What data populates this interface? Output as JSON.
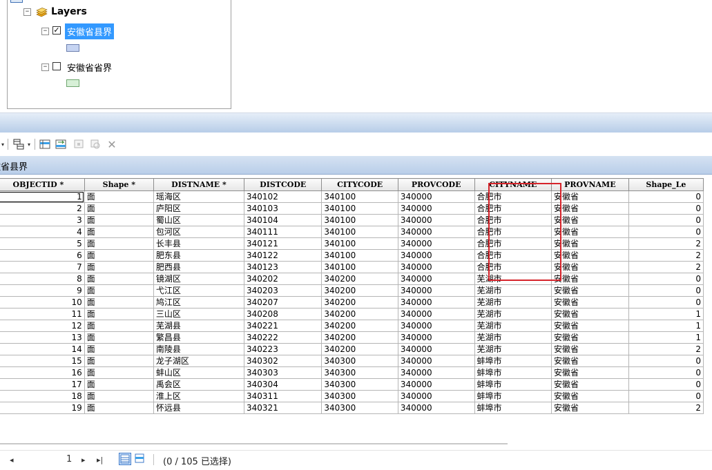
{
  "toc": {
    "root_label": "Layers",
    "layers": [
      {
        "name": "安徽省县界",
        "checked": true,
        "selected": true,
        "swatch_color": "#c6d4f2"
      },
      {
        "name": "安徽省省界",
        "checked": false,
        "selected": false,
        "swatch_color": "#d7f0d7"
      }
    ]
  },
  "table_window": {
    "tab_label": "徽省县界",
    "columns": [
      "OBJECTID *",
      "Shape *",
      "DISTNAME *",
      "DISTCODE",
      "CITYCODE",
      "PROVCODE",
      "CITYNAME",
      "PROVNAME",
      "Shape_Le"
    ],
    "rows": [
      [
        "1",
        "面",
        "瑶海区",
        "340102",
        "340100",
        "340000",
        "合肥市",
        "安徽省",
        "0"
      ],
      [
        "2",
        "面",
        "庐阳区",
        "340103",
        "340100",
        "340000",
        "合肥市",
        "安徽省",
        "0"
      ],
      [
        "3",
        "面",
        "蜀山区",
        "340104",
        "340100",
        "340000",
        "合肥市",
        "安徽省",
        "0"
      ],
      [
        "4",
        "面",
        "包河区",
        "340111",
        "340100",
        "340000",
        "合肥市",
        "安徽省",
        "0"
      ],
      [
        "5",
        "面",
        "长丰县",
        "340121",
        "340100",
        "340000",
        "合肥市",
        "安徽省",
        "2"
      ],
      [
        "6",
        "面",
        "肥东县",
        "340122",
        "340100",
        "340000",
        "合肥市",
        "安徽省",
        "2"
      ],
      [
        "7",
        "面",
        "肥西县",
        "340123",
        "340100",
        "340000",
        "合肥市",
        "安徽省",
        "2"
      ],
      [
        "8",
        "面",
        "镜湖区",
        "340202",
        "340200",
        "340000",
        "芜湖市",
        "安徽省",
        "0"
      ],
      [
        "9",
        "面",
        "弋江区",
        "340203",
        "340200",
        "340000",
        "芜湖市",
        "安徽省",
        "0"
      ],
      [
        "10",
        "面",
        "鸠江区",
        "340207",
        "340200",
        "340000",
        "芜湖市",
        "安徽省",
        "0"
      ],
      [
        "11",
        "面",
        "三山区",
        "340208",
        "340200",
        "340000",
        "芜湖市",
        "安徽省",
        "1"
      ],
      [
        "12",
        "面",
        "芜湖县",
        "340221",
        "340200",
        "340000",
        "芜湖市",
        "安徽省",
        "1"
      ],
      [
        "13",
        "面",
        "繁昌县",
        "340222",
        "340200",
        "340000",
        "芜湖市",
        "安徽省",
        "1"
      ],
      [
        "14",
        "面",
        "南陵县",
        "340223",
        "340200",
        "340000",
        "芜湖市",
        "安徽省",
        "2"
      ],
      [
        "15",
        "面",
        "龙子湖区",
        "340302",
        "340300",
        "340000",
        "蚌埠市",
        "安徽省",
        "0"
      ],
      [
        "16",
        "面",
        "蚌山区",
        "340303",
        "340300",
        "340000",
        "蚌埠市",
        "安徽省",
        "0"
      ],
      [
        "17",
        "面",
        "禹会区",
        "340304",
        "340300",
        "340000",
        "蚌埠市",
        "安徽省",
        "0"
      ],
      [
        "18",
        "面",
        "淮上区",
        "340311",
        "340300",
        "340000",
        "蚌埠市",
        "安徽省",
        "0"
      ],
      [
        "19",
        "面",
        "怀远县",
        "340321",
        "340300",
        "340000",
        "蚌埠市",
        "安徽省",
        "2"
      ]
    ],
    "status": {
      "current_record": "1",
      "selection_text": "(0 / 105 已选择)"
    },
    "highlight_color": "#d6232a"
  }
}
